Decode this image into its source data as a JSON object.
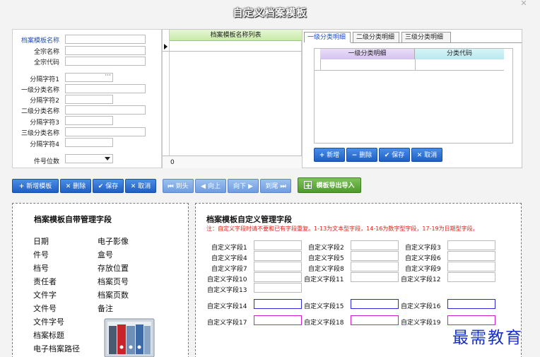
{
  "window": {
    "title": "自定义档案模板",
    "close_glyph": "✕"
  },
  "form": {
    "template_name_label": "档案模板名称",
    "fonds_name_label": "全宗名称",
    "fonds_code_label": "全宗代码",
    "sep1_label": "分隔字符1",
    "sep1_button": "···",
    "level1_name_label": "一级分类名称",
    "sep2_label": "分隔字符2",
    "level2_name_label": "二级分类名称",
    "sep3_label": "分隔字符3",
    "level3_name_label": "三级分类名称",
    "sep4_label": "分隔字符4",
    "item_digits_label": "件号位数"
  },
  "template_list": {
    "header": "档案模板名称列表",
    "footer_count": "0"
  },
  "tabs": [
    {
      "label": "一级分类明细",
      "active": true
    },
    {
      "label": "二级分类明细",
      "active": false
    },
    {
      "label": "三级分类明细",
      "active": false
    }
  ],
  "detail_grid": {
    "col1": "一级分类明细",
    "col2": "分类代码"
  },
  "detail_buttons": {
    "add": "新增",
    "delete": "删除",
    "save": "保存",
    "cancel": "取消"
  },
  "toolbar": {
    "add_template": "新增模板",
    "delete": "删除",
    "save": "保存",
    "cancel": "取消",
    "to_first": "到头",
    "up": "向上",
    "down": "向下",
    "to_last": "到尾",
    "import_export": "模板导出导入"
  },
  "builtin_fields": {
    "title": "档案模板自带管理字段",
    "col1": [
      "日期",
      "件号",
      "档号",
      "责任者",
      "文件字",
      "文件号",
      "文件字号",
      "档案标题",
      "电子档案路径"
    ],
    "col2": [
      "电子影像",
      "盒号",
      "存放位置",
      "档案页号",
      "档案页数",
      "备注"
    ]
  },
  "custom_fields": {
    "title": "档案模板自定义管理字段",
    "note": "注：自定义字段时请不要和已有字段重复。1-13为文本型字段，14-16为数字型字段，17-19为日期型字段。",
    "labels": [
      "自定义字段1",
      "自定义字段2",
      "自定义字段3",
      "自定义字段4",
      "自定义字段5",
      "自定义字段6",
      "自定义字段7",
      "自定义字段8",
      "自定义字段9",
      "自定义字段10",
      "自定义字段11",
      "自定义字段12",
      "自定义字段13",
      "自定义字段14",
      "自定义字段15",
      "自定义字段16",
      "自定义字段17",
      "自定义字段18",
      "自定义字段19"
    ]
  },
  "watermark": "最需教育",
  "colors": {
    "accent_blue": "#1f5fc4",
    "green": "#4f9a2b",
    "note_red": "#e0201a",
    "grid_green_header": "#c8eaa7"
  }
}
